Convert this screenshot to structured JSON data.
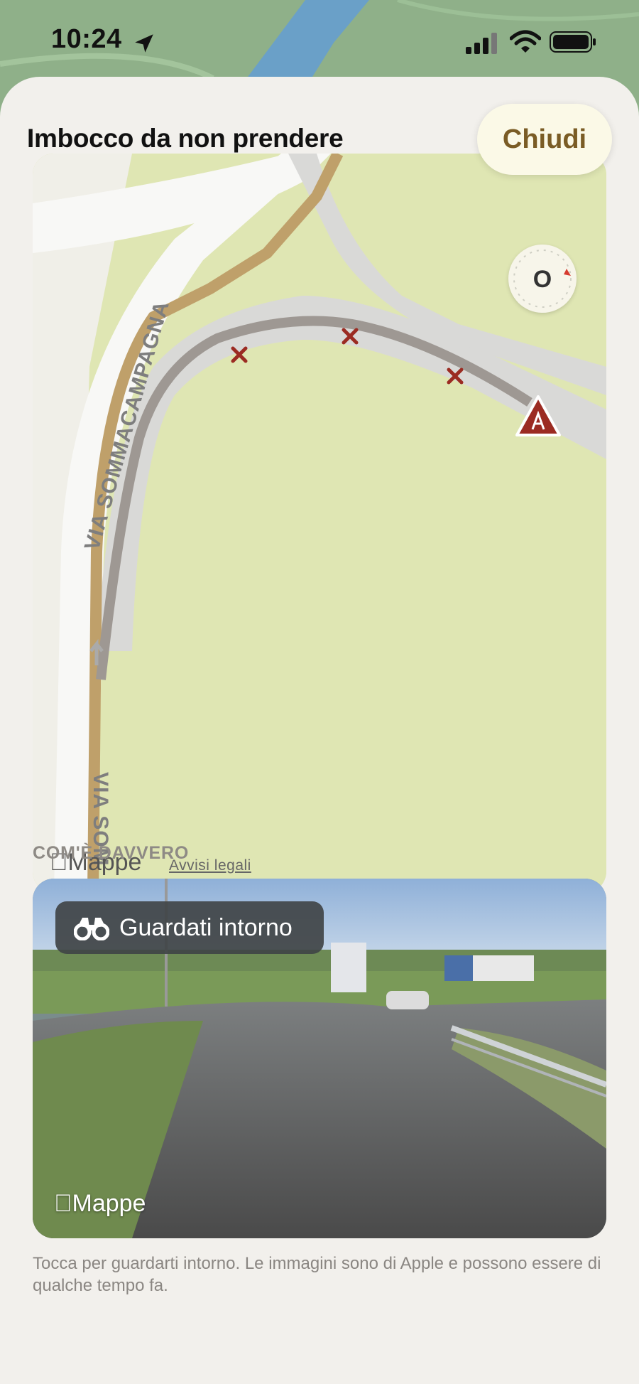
{
  "status_bar": {
    "time": "10:24",
    "icons": [
      "location-arrow-icon",
      "cellular-signal-icon",
      "wifi-icon",
      "battery-icon"
    ]
  },
  "sheet": {
    "title": "Imbocco da non prendere",
    "close_label": "Chiudi"
  },
  "map": {
    "street_label_1": "VIA SOMMACAMPAGNA",
    "street_label_2": "VIA SOM",
    "brand": "Mappe",
    "legal_link": "Avvisi legali",
    "compass_letter": "O",
    "markers": [
      "x-marker-icon",
      "x-marker-icon",
      "x-marker-icon",
      "warning-triangle-icon"
    ]
  },
  "real_view": {
    "section_label": "COM'È DAVVERO",
    "look_around_label": "Guardati intorno",
    "brand": "Mappe",
    "footnote": "Tocca per guardarti intorno. Le immagini sono di Apple e possono essere di qualche tempo fa."
  },
  "colors": {
    "sheet_bg": "#f2f0ec",
    "map_land": "#dfe6b3",
    "road_gray": "#d6d6d6",
    "route_brown": "#bfa06a",
    "marker_red": "#9b2b22",
    "close_text": "#7a5c25"
  }
}
